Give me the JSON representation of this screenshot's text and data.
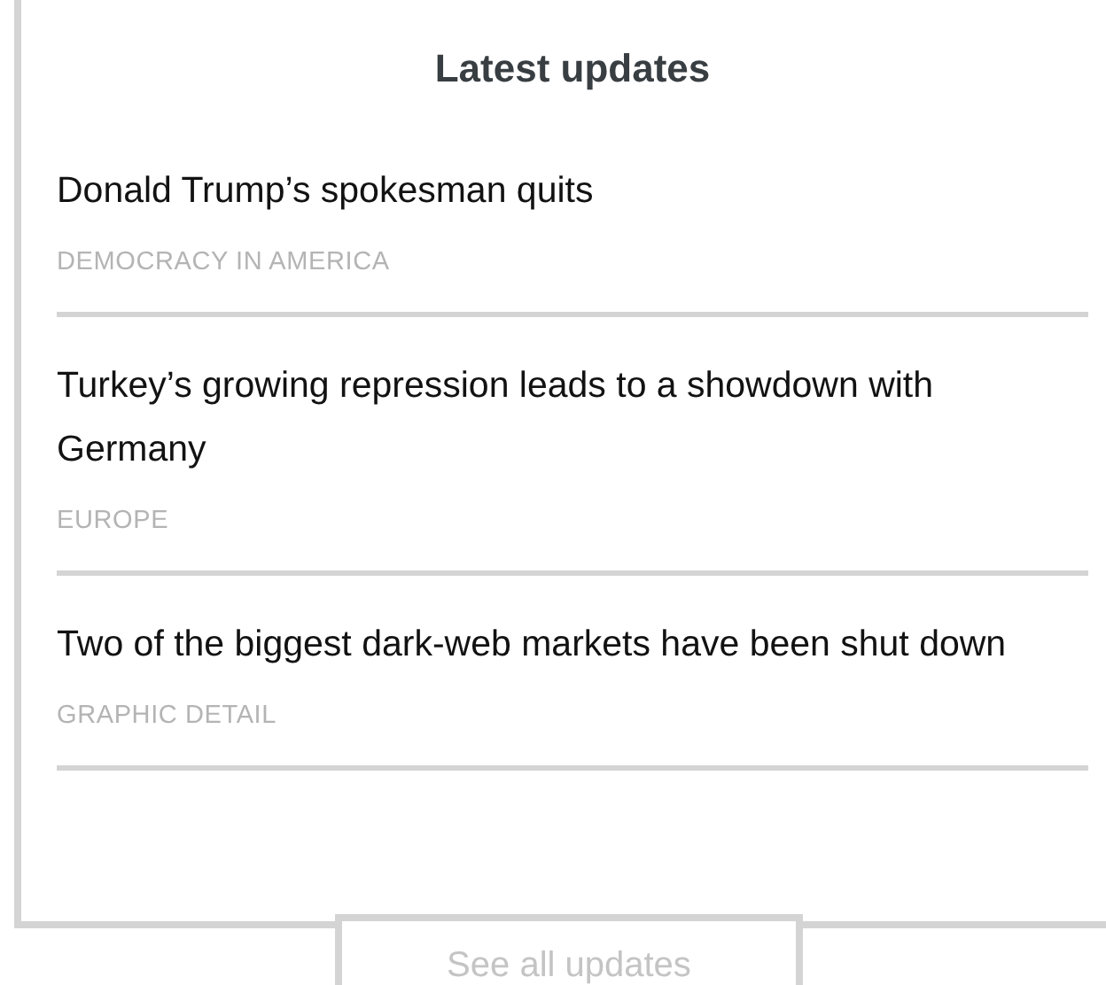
{
  "title": "Latest updates",
  "items": [
    {
      "headline": "Donald Trump’s spokesman quits",
      "section": "DEMOCRACY IN AMERICA"
    },
    {
      "headline": "Turkey’s growing repression leads to a showdown with Germany",
      "section": "EUROPE"
    },
    {
      "headline": "Two of the biggest dark-web markets have been shut down",
      "section": "GRAPHIC DETAIL"
    }
  ],
  "button": "See all updates"
}
